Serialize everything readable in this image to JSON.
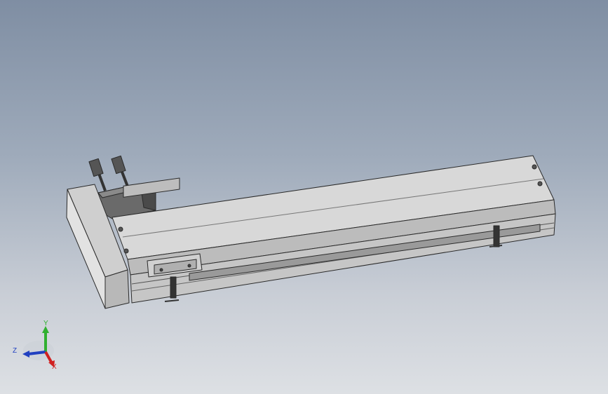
{
  "viewport": {
    "colors": {
      "bg_top": "#7f8ea3",
      "bg_bottom": "#dde0e4",
      "part": "#d3d3d3",
      "edge": "#2a2a2a"
    }
  },
  "triad": {
    "x_label": "X",
    "y_label": "Y",
    "z_label": "Z",
    "colors": {
      "x": "#d02020",
      "y": "#30b030",
      "z": "#2040c0"
    }
  }
}
